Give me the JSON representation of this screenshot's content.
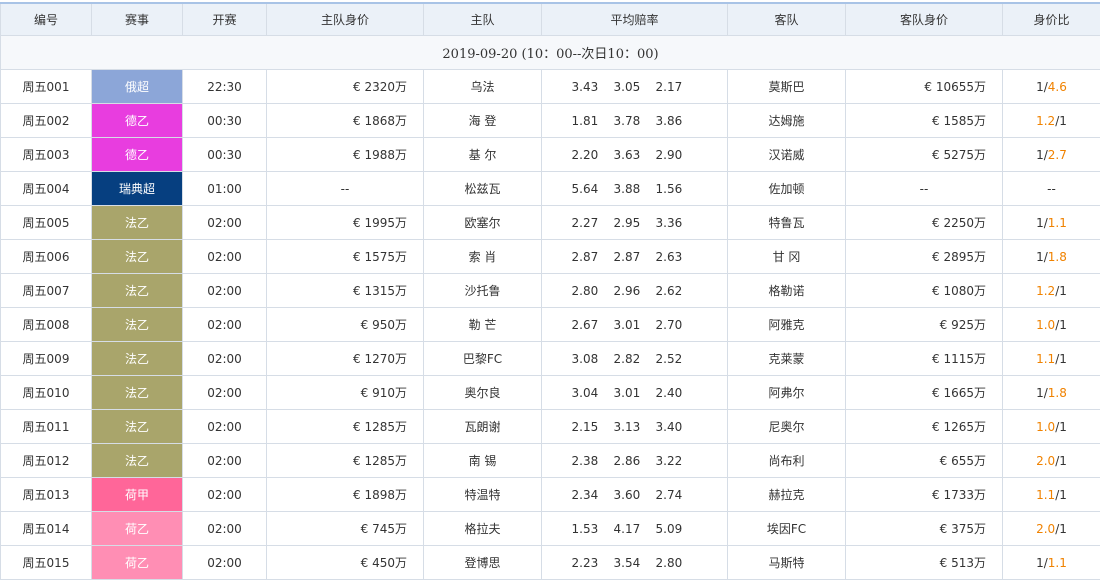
{
  "headers": [
    "编号",
    "赛事",
    "开赛",
    "主队身价",
    "主队",
    "平均赔率",
    "客队",
    "客队身价",
    "身价比"
  ],
  "date_label": "2019-09-20 (10：00--次日10：00)",
  "colors": {
    "俄超": "#8ca6d8",
    "德乙": "#e83ddf",
    "瑞典超": "#063f80",
    "法乙": "#a9a56b",
    "荷甲": "#ff6699",
    "荷乙": "#ff8eb4",
    "highlight": "#f08200"
  },
  "rows": [
    {
      "id": "周五001",
      "league": "俄超",
      "time": "22:30",
      "home_value": "€ 2320万",
      "home": "乌法",
      "odds": [
        "3.43",
        "3.05",
        "2.17"
      ],
      "away": "莫斯巴",
      "away_value": "€ 10655万",
      "ratio": [
        "1/",
        "4.6"
      ],
      "ratio_hl": 1
    },
    {
      "id": "周五002",
      "league": "德乙",
      "time": "00:30",
      "home_value": "€ 1868万",
      "home": "海 登",
      "odds": [
        "1.81",
        "3.78",
        "3.86"
      ],
      "away": "达姆施",
      "away_value": "€ 1585万",
      "ratio": [
        "1.2",
        "/1"
      ],
      "ratio_hl": 0
    },
    {
      "id": "周五003",
      "league": "德乙",
      "time": "00:30",
      "home_value": "€ 1988万",
      "home": "基 尔",
      "odds": [
        "2.20",
        "3.63",
        "2.90"
      ],
      "away": "汉诺威",
      "away_value": "€ 5275万",
      "ratio": [
        "1/",
        "2.7"
      ],
      "ratio_hl": 1
    },
    {
      "id": "周五004",
      "league": "瑞典超",
      "time": "01:00",
      "home_value": "--",
      "home": "松兹瓦",
      "odds": [
        "5.64",
        "3.88",
        "1.56"
      ],
      "away": "佐加顿",
      "away_value": "--",
      "ratio": [
        "--",
        ""
      ],
      "ratio_hl": -1
    },
    {
      "id": "周五005",
      "league": "法乙",
      "time": "02:00",
      "home_value": "€ 1995万",
      "home": "欧塞尔",
      "odds": [
        "2.27",
        "2.95",
        "3.36"
      ],
      "away": "特鲁瓦",
      "away_value": "€ 2250万",
      "ratio": [
        "1/",
        "1.1"
      ],
      "ratio_hl": 1
    },
    {
      "id": "周五006",
      "league": "法乙",
      "time": "02:00",
      "home_value": "€ 1575万",
      "home": "索 肖",
      "odds": [
        "2.87",
        "2.87",
        "2.63"
      ],
      "away": "甘 冈",
      "away_value": "€ 2895万",
      "ratio": [
        "1/",
        "1.8"
      ],
      "ratio_hl": 1
    },
    {
      "id": "周五007",
      "league": "法乙",
      "time": "02:00",
      "home_value": "€ 1315万",
      "home": "沙托鲁",
      "odds": [
        "2.80",
        "2.96",
        "2.62"
      ],
      "away": "格勒诺",
      "away_value": "€ 1080万",
      "ratio": [
        "1.2",
        "/1"
      ],
      "ratio_hl": 0
    },
    {
      "id": "周五008",
      "league": "法乙",
      "time": "02:00",
      "home_value": "€ 950万",
      "home": "勒 芒",
      "odds": [
        "2.67",
        "3.01",
        "2.70"
      ],
      "away": "阿雅克",
      "away_value": "€ 925万",
      "ratio": [
        "1.0",
        "/1"
      ],
      "ratio_hl": 0
    },
    {
      "id": "周五009",
      "league": "法乙",
      "time": "02:00",
      "home_value": "€ 1270万",
      "home": "巴黎FC",
      "odds": [
        "3.08",
        "2.82",
        "2.52"
      ],
      "away": "克莱蒙",
      "away_value": "€ 1115万",
      "ratio": [
        "1.1",
        "/1"
      ],
      "ratio_hl": 0
    },
    {
      "id": "周五010",
      "league": "法乙",
      "time": "02:00",
      "home_value": "€ 910万",
      "home": "奥尔良",
      "odds": [
        "3.04",
        "3.01",
        "2.40"
      ],
      "away": "阿弗尔",
      "away_value": "€ 1665万",
      "ratio": [
        "1/",
        "1.8"
      ],
      "ratio_hl": 1
    },
    {
      "id": "周五011",
      "league": "法乙",
      "time": "02:00",
      "home_value": "€ 1285万",
      "home": "瓦朗谢",
      "odds": [
        "2.15",
        "3.13",
        "3.40"
      ],
      "away": "尼奥尔",
      "away_value": "€ 1265万",
      "ratio": [
        "1.0",
        "/1"
      ],
      "ratio_hl": 0
    },
    {
      "id": "周五012",
      "league": "法乙",
      "time": "02:00",
      "home_value": "€ 1285万",
      "home": "南 锡",
      "odds": [
        "2.38",
        "2.86",
        "3.22"
      ],
      "away": "尚布利",
      "away_value": "€ 655万",
      "ratio": [
        "2.0",
        "/1"
      ],
      "ratio_hl": 0
    },
    {
      "id": "周五013",
      "league": "荷甲",
      "time": "02:00",
      "home_value": "€ 1898万",
      "home": "特温特",
      "odds": [
        "2.34",
        "3.60",
        "2.74"
      ],
      "away": "赫拉克",
      "away_value": "€ 1733万",
      "ratio": [
        "1.1",
        "/1"
      ],
      "ratio_hl": 0
    },
    {
      "id": "周五014",
      "league": "荷乙",
      "time": "02:00",
      "home_value": "€ 745万",
      "home": "格拉夫",
      "odds": [
        "1.53",
        "4.17",
        "5.09"
      ],
      "away": "埃因FC",
      "away_value": "€ 375万",
      "ratio": [
        "2.0",
        "/1"
      ],
      "ratio_hl": 0
    },
    {
      "id": "周五015",
      "league": "荷乙",
      "time": "02:00",
      "home_value": "€ 450万",
      "home": "登博思",
      "odds": [
        "2.23",
        "3.54",
        "2.80"
      ],
      "away": "马斯特",
      "away_value": "€ 513万",
      "ratio": [
        "1/",
        "1.1"
      ],
      "ratio_hl": 1
    }
  ]
}
